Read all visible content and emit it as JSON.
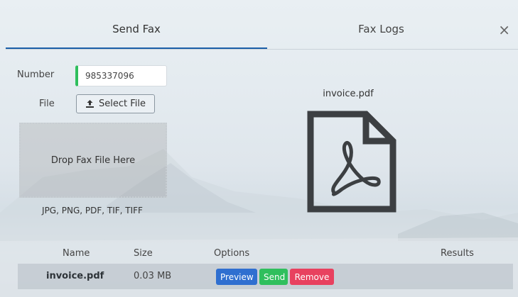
{
  "tabs": [
    {
      "label": "Send Fax",
      "active": true
    },
    {
      "label": "Fax Logs",
      "active": false
    }
  ],
  "close_icon": "×",
  "form": {
    "number_label": "Number",
    "number_value": "985337096",
    "file_label": "File",
    "select_file_label": "Select File",
    "upload_icon": "upload-icon"
  },
  "dropzone": {
    "text": "Drop Fax File Here",
    "formats": "JPG, PNG, PDF, TIF, TIFF"
  },
  "preview": {
    "filename": "invoice.pdf",
    "icon": "pdf-file-icon"
  },
  "table": {
    "headers": {
      "name": "Name",
      "size": "Size",
      "options": "Options",
      "results": "Results"
    },
    "rows": [
      {
        "name": "invoice.pdf",
        "size": "0.03 MB",
        "preview_label": "Preview",
        "send_label": "Send",
        "remove_label": "Remove",
        "result": ""
      }
    ]
  },
  "colors": {
    "accent": "#1b5fa8",
    "preview_btn": "#2f6fd0",
    "send_btn": "#2fbf5d",
    "remove_btn": "#e8415f"
  }
}
